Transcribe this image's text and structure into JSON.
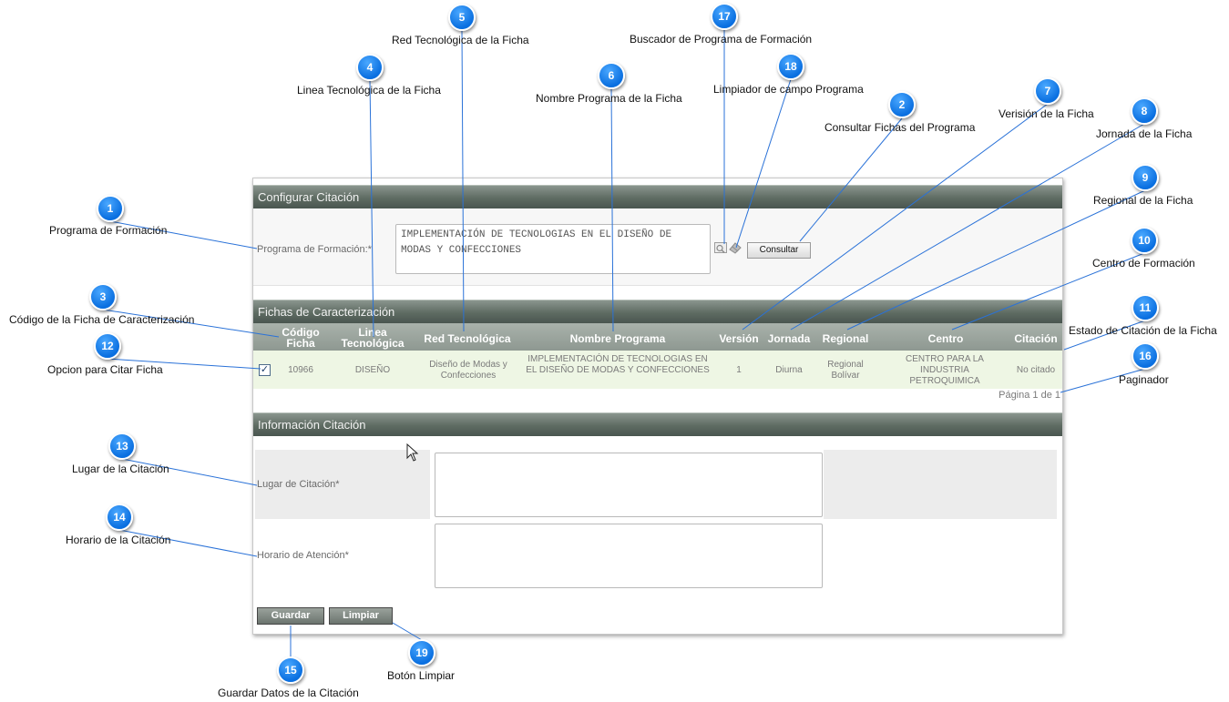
{
  "config_section": {
    "title": "Configurar Citación",
    "program_label": "Programa de Formación:*",
    "program_value": "IMPLEMENTACIÓN DE TECNOLOGIAS EN EL DISEÑO DE MODAS Y CONFECCIONES",
    "consult_button": "Consultar"
  },
  "fichas_section": {
    "title": "Fichas de Caracterización",
    "headers": {
      "codigo": "Código Ficha",
      "linea": "Linea Tecnológica",
      "red": "Red Tecnológica",
      "programa": "Nombre Programa",
      "version": "Versión",
      "jornada": "Jornada",
      "regional": "Regional",
      "centro": "Centro",
      "citacion": "Citación"
    },
    "rows": [
      {
        "checked": true,
        "codigo": "10966",
        "linea": "DISEÑO",
        "red": "Diseño de Modas y Confecciones",
        "programa": "IMPLEMENTACIÓN DE TECNOLOGIAS EN EL DISEÑO DE MODAS Y CONFECCIONES",
        "version": "1",
        "jornada": "Diurna",
        "regional": "Regional Bolívar",
        "centro": "CENTRO PARA LA INDUSTRIA PETROQUIMICA",
        "citacion": "No citado"
      }
    ],
    "pager": "Página 1 de 1"
  },
  "info_section": {
    "title": "Información Citación",
    "lugar_label": "Lugar de Citación*",
    "horario_label": "Horario de Atención*",
    "save_button": "Guardar",
    "clear_button": "Limpiar"
  },
  "annotations": [
    {
      "n": "1",
      "text": "Programa de Formación"
    },
    {
      "n": "2",
      "text": "Consultar Fichas del Programa"
    },
    {
      "n": "3",
      "text": "Código de la Ficha de Caracterización"
    },
    {
      "n": "4",
      "text": "Linea Tecnológica de la Ficha"
    },
    {
      "n": "5",
      "text": "Red Tecnológica de la Ficha"
    },
    {
      "n": "6",
      "text": "Nombre Programa de la Ficha"
    },
    {
      "n": "7",
      "text": "Verisión de la Ficha"
    },
    {
      "n": "8",
      "text": "Jornada de la Ficha"
    },
    {
      "n": "9",
      "text": "Regional de la Ficha"
    },
    {
      "n": "10",
      "text": "Centro de Formación"
    },
    {
      "n": "11",
      "text": "Estado de Citación de la Ficha"
    },
    {
      "n": "12",
      "text": "Opcion para Citar Ficha"
    },
    {
      "n": "13",
      "text": "Lugar de la Citación"
    },
    {
      "n": "14",
      "text": "Horario de la Citación"
    },
    {
      "n": "15",
      "text": "Guardar Datos de la Citación"
    },
    {
      "n": "16",
      "text": "Paginador"
    },
    {
      "n": "17",
      "text": "Buscador de Programa de Formación"
    },
    {
      "n": "18",
      "text": "Limpiador de campo Programa"
    },
    {
      "n": "19",
      "text": "Botón Limpiar"
    }
  ],
  "colors": {
    "header_gradient_top": "#8a958e",
    "header_gradient_bottom": "#4a5650",
    "callout_blue": "#0a6fe0",
    "row_highlight": "#eef6e4"
  }
}
